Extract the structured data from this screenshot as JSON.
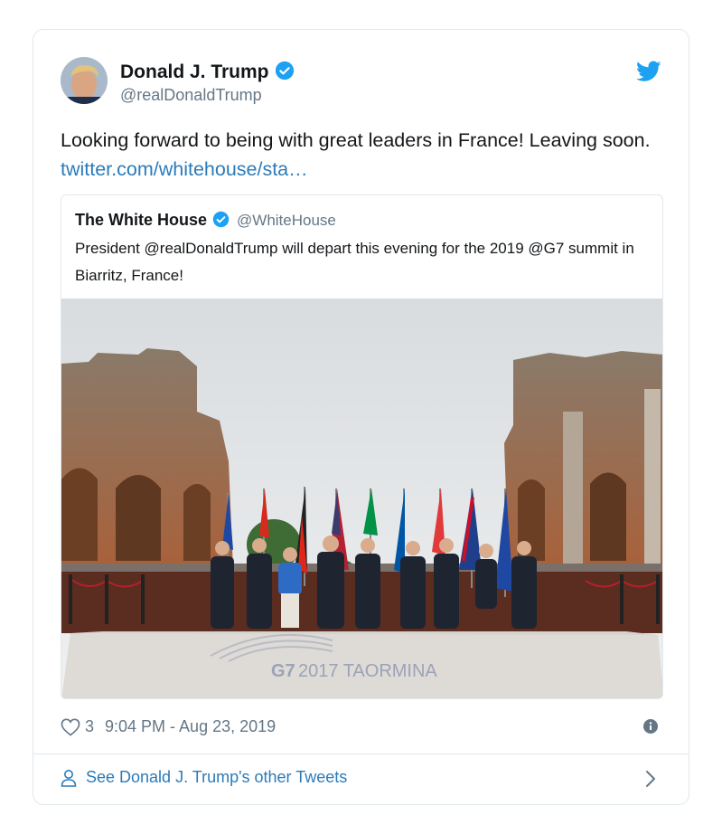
{
  "tweet": {
    "author_name": "Donald J. Trump",
    "author_handle": "@realDonaldTrump",
    "text": "Looking forward to being with great leaders in France! Leaving soon.",
    "link_text": "twitter.com/whitehouse/sta…",
    "like_count": "3",
    "timestamp": "9:04 PM - Aug 23, 2019"
  },
  "quoted": {
    "author_name": "The White House",
    "author_handle": "@WhiteHouse",
    "text": "President @realDonaldTrump will depart this evening for the 2019 @G7 summit in Biarritz, France!",
    "image_caption": "G7 2017 TAORMINA"
  },
  "footer": {
    "label": "See Donald J. Trump's other Tweets"
  },
  "colors": {
    "link": "#2b7bb9",
    "verified": "#1da1f2",
    "muted": "#657786"
  },
  "icons": [
    "verified-badge-icon",
    "twitter-bird-icon",
    "heart-icon",
    "info-icon",
    "person-icon",
    "chevron-right-icon"
  ]
}
